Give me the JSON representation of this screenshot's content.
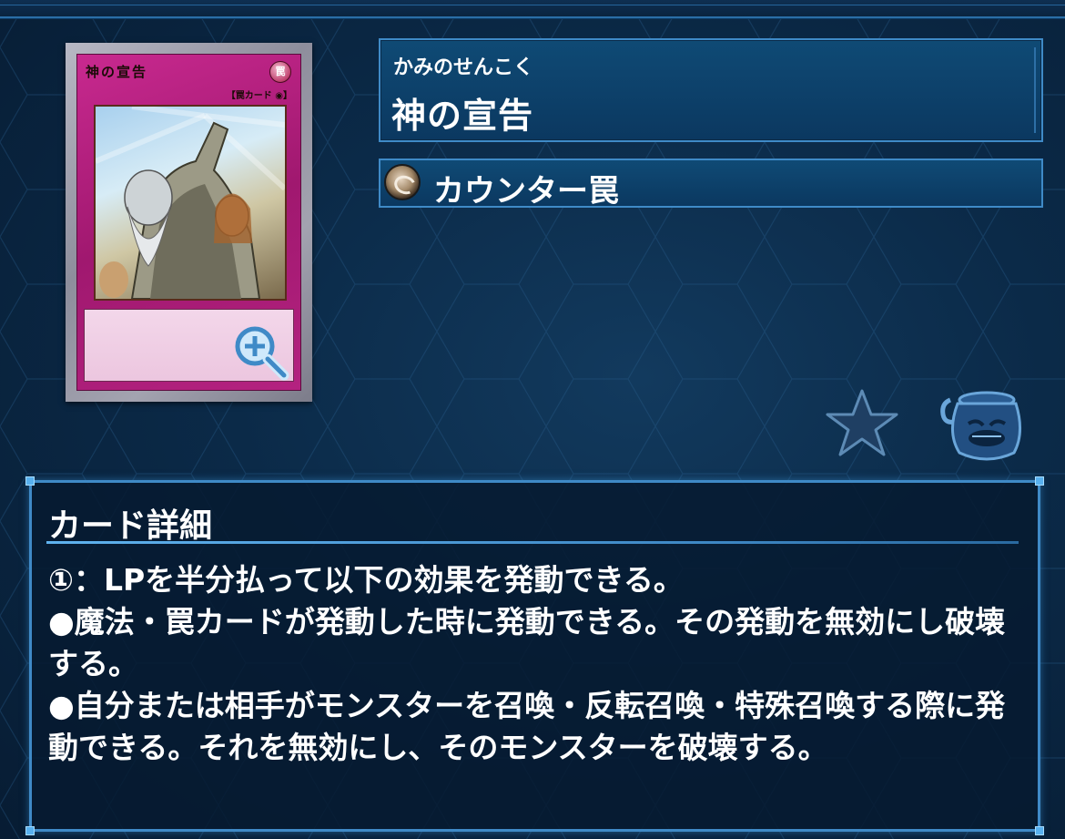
{
  "card": {
    "frame_name": "神の宣告",
    "attribute_glyph": "罠",
    "type_bracket": "【罠カード ◉】",
    "frame_color": "#b4237f",
    "icon": "card-art-elder-raising-hand"
  },
  "header": {
    "ruby": "かみのせんこく",
    "name": "神の宣告"
  },
  "type": {
    "label": "カウンター罠",
    "icon": "counter-trap-icon"
  },
  "actions": {
    "zoom_icon": "magnify-plus-icon",
    "favorite_icon": "star-icon",
    "pot_icon": "pot-of-greed-icon"
  },
  "detail": {
    "title": "カード詳細",
    "lines": [
      "①：LPを半分払って以下の効果を発動できる。",
      "●魔法・罠カードが発動した時に発動できる。その発動を無効にし破壊する。",
      "●自分または相手がモンスターを召喚・反転召喚・特殊召喚する際に発動できる。それを無効にし、そのモンスターを破壊する。"
    ]
  },
  "colors": {
    "panel_border": "#3f8ac7",
    "panel_fill": "#0f4a75",
    "background": "#0b2a48",
    "accent": "#58b0ee"
  }
}
